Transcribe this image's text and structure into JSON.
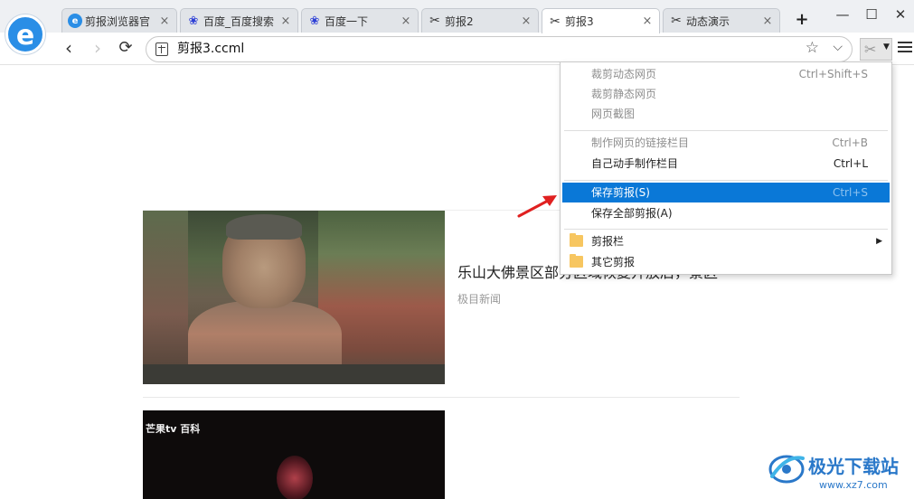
{
  "browser": {
    "logo_letter": "e",
    "tabs": [
      {
        "label": "剪报浏览器官",
        "icon": "browser-icon",
        "active": false
      },
      {
        "label": "百度_百度搜索",
        "icon": "paw-icon",
        "active": false
      },
      {
        "label": "百度一下",
        "icon": "paw-icon",
        "active": false
      },
      {
        "label": "剪报2",
        "icon": "scissors-icon",
        "active": false
      },
      {
        "label": "剪报3",
        "icon": "scissors-icon",
        "active": true
      },
      {
        "label": "动态演示",
        "icon": "scissors-icon",
        "active": false
      }
    ],
    "new_tab": "+",
    "close_glyph": "×",
    "window_controls": {
      "minimize": "—",
      "maximize": "☐",
      "close": "✕"
    }
  },
  "toolbar": {
    "back": "‹",
    "forward": "›",
    "refresh": "⟳",
    "address": "剪报3.ccml",
    "favorite_glyph": "☆",
    "dropdown_glyph": "⌵",
    "clip_glyph": "✂",
    "clip_dropdown_glyph": "▼"
  },
  "content": {
    "news": [
      {
        "title": "乐山大佛景区部分区域恢复开放后，景区",
        "source": "极目新闻"
      },
      {
        "image_caption": "芒果tv 百科"
      }
    ]
  },
  "menu": {
    "groups": [
      [
        {
          "label": "裁剪动态网页",
          "shortcut": "Ctrl+Shift+S",
          "disabled": true
        },
        {
          "label": "裁剪静态网页",
          "shortcut": "",
          "disabled": true
        },
        {
          "label": "网页截图",
          "shortcut": "",
          "disabled": true
        }
      ],
      [
        {
          "label": "制作网页的链接栏目",
          "shortcut": "Ctrl+B",
          "disabled": true
        },
        {
          "label": "自己动手制作栏目",
          "shortcut": "Ctrl+L",
          "disabled": false
        }
      ],
      [
        {
          "label": "保存剪报(S)",
          "shortcut": "Ctrl+S",
          "disabled": false,
          "highlighted": true
        },
        {
          "label": "保存全部剪报(A)",
          "shortcut": "",
          "disabled": false
        }
      ],
      [
        {
          "label": "剪报栏",
          "submenu_glyph": "▶",
          "folder": true
        },
        {
          "label": "其它剪报",
          "folder": true
        }
      ]
    ]
  },
  "watermark": {
    "name": "极光下载站",
    "url": "www.xz7.com"
  },
  "colors": {
    "highlight": "#0a78d7",
    "watermark": "#2a78c9",
    "pointer": "#e02020"
  }
}
